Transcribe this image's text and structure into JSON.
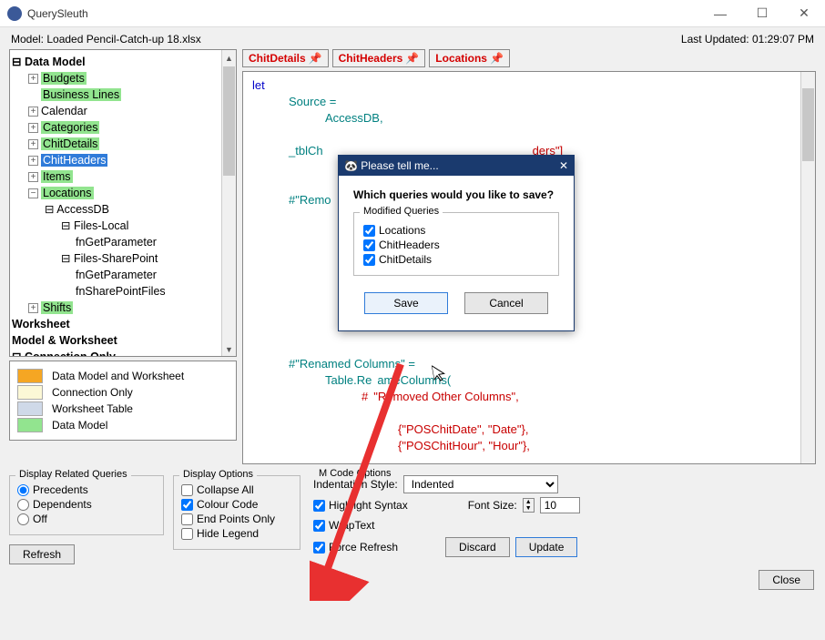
{
  "app": {
    "title": "QuerySleuth"
  },
  "status": {
    "model": "Model: Loaded Pencil-Catch-up 18.xlsx",
    "updated": "Last Updated: 01:29:07 PM"
  },
  "tree": {
    "root": "Data Model",
    "items": [
      "Budgets",
      "Business Lines",
      "Calendar",
      "Categories",
      "ChitDetails",
      "ChitHeaders",
      "Items",
      "Locations",
      "Shifts"
    ],
    "loc_children": {
      "accessdb": "AccessDB",
      "fileslocal": "Files-Local",
      "fn1": "fnGetParameter",
      "filessp": "Files-SharePoint",
      "fn2": "fnGetParameter",
      "fn3": "fnSharePointFiles"
    },
    "sections": {
      "worksheet": "Worksheet",
      "mw": "Model & Worksheet",
      "conn": "Connection Only"
    }
  },
  "legend": {
    "a": "Data Model and Worksheet",
    "b": "Connection Only",
    "c": "Worksheet Table",
    "d": "Data Model"
  },
  "tabs": {
    "a": "ChitDetails",
    "b": "ChitHeaders",
    "c": "Locations"
  },
  "code": {
    "l1": "let",
    "l2": "Source =",
    "l3": "AccessDB,",
    "l4a": "_tblCh",
    "l4b": "ders\"]",
    "l5": "#\"Remo",
    "l6": "#\"Renamed Columns\" =",
    "l7": "Table.Re",
    "l7b": "ameColumns(",
    "l8": "\"Removed Other Columns\",",
    "l9": "{\"POSChitDate\", \"Date\"},",
    "l10": "{\"POSChitHour\", \"Hour\"},"
  },
  "related": {
    "title": "Display Related Queries",
    "opt1": "Precedents",
    "opt2": "Dependents",
    "opt3": "Off",
    "refresh": "Refresh"
  },
  "dispopts": {
    "title": "Display Options",
    "a": "Collapse All",
    "b": "Colour Code",
    "c": "End Points Only",
    "d": "Hide Legend"
  },
  "mcode": {
    "title": "M Code Options",
    "indentlbl": "Indentation Style:",
    "indentval": "Indented",
    "hs": "Highlight Syntax",
    "wt": "WrapText",
    "fr": "Force Refresh",
    "fontlbl": "Font Size:",
    "fontval": "10",
    "discard": "Discard",
    "update": "Update"
  },
  "close": "Close",
  "modal": {
    "title": "Please tell me...",
    "question": "Which queries would you like to save?",
    "group": "Modified Queries",
    "q1": "Locations",
    "q2": "ChitHeaders",
    "q3": "ChitDetails",
    "save": "Save",
    "cancel": "Cancel"
  }
}
